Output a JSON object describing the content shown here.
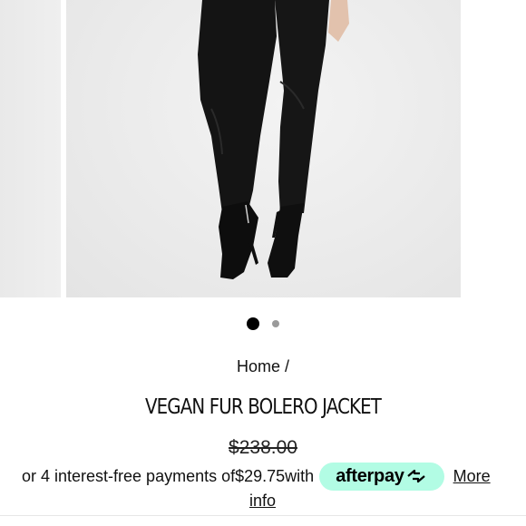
{
  "gallery": {
    "images": [
      {
        "alt": "product-photo-1",
        "state": "previous"
      },
      {
        "alt": "product-photo-2",
        "state": "current"
      }
    ],
    "zoom_icon": "magnifier-icon",
    "dots": [
      {
        "active": true
      },
      {
        "active": false
      }
    ]
  },
  "breadcrumb": {
    "home": "Home",
    "separator": " /"
  },
  "product": {
    "title": "VEGAN FUR BOLERO JACKET",
    "price": "$238.00"
  },
  "afterpay": {
    "text_before": "or 4 interest-free payments of ",
    "installment": "$29.75",
    "text_after": " with",
    "badge_label": "afterpay",
    "badge_color": "#b2fce4",
    "more_label": "More",
    "info_label": "info"
  }
}
